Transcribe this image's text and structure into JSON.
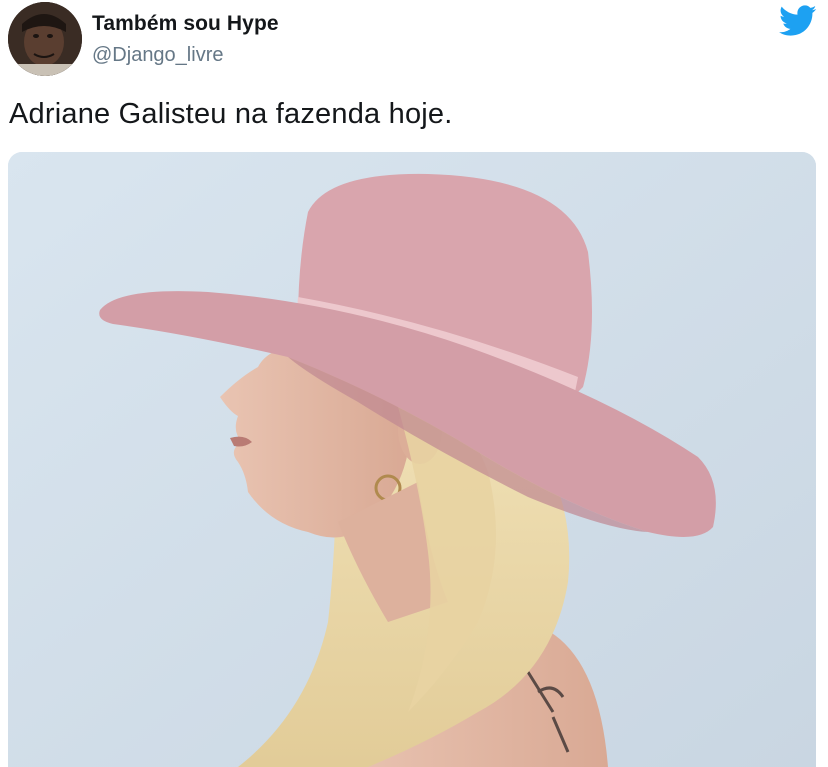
{
  "author": {
    "display_name": "Também sou Hype",
    "handle": "@Django_livre",
    "avatar_icon": "user-avatar"
  },
  "tweet": {
    "text": "Adriane Galisteu na fazenda hoje."
  },
  "brand": {
    "icon": "twitter-bird-icon",
    "color": "#1da1f2"
  },
  "media": {
    "type": "photo",
    "icon": "photo-woman-pink-hat"
  },
  "colors": {
    "name": "#14171a",
    "handle": "#657786",
    "photo_background": "#dbe6ef",
    "hat": "#d8a3ab",
    "hair": "#ecd9a8"
  }
}
